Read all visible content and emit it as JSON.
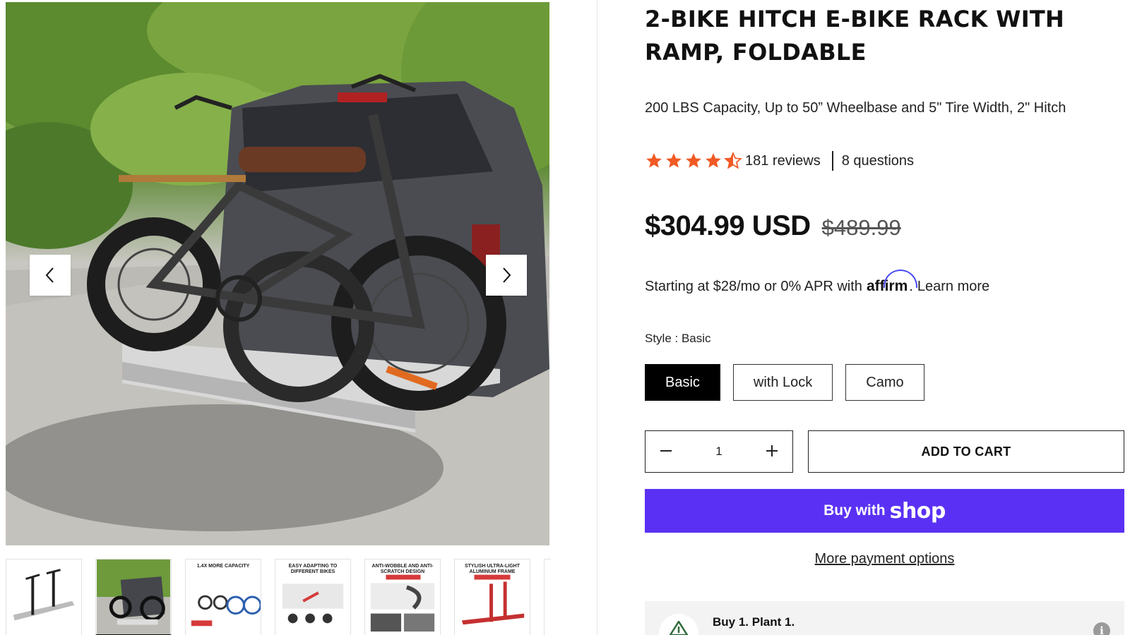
{
  "gallery": {
    "main_image_alt": "",
    "thumbnails": [
      {
        "caption": ""
      },
      {
        "caption": ""
      },
      {
        "caption": "1.4X MORE CAPACITY"
      },
      {
        "caption": "EASY ADAPTING TO DIFFERENT BIKES"
      },
      {
        "caption": "ANTI-WOBBLE AND ANTI-SCRATCH DESIGN"
      },
      {
        "caption": "STYLISH ULTRA-LIGHT ALUMINUM FRAME"
      },
      {
        "caption": ""
      }
    ],
    "prev_icon": "chevron-left-icon",
    "next_icon": "chevron-right-icon"
  },
  "product": {
    "title": "2-BIKE HITCH E-BIKE RACK WITH RAMP, FOLDABLE",
    "subtitle": "200 LBS Capacity, Up to 50” Wheelbase and 5\" Tire Width, 2\" Hitch",
    "rating_value": 4.5,
    "reviews_label": "181 reviews",
    "questions_label": "8 questions",
    "price": "$304.99 USD",
    "compare_price": "$489.99",
    "star_color": "#f15a24"
  },
  "affirm": {
    "prefix": "Starting at $28/mo or 0% APR with",
    "logo": "affirm",
    "suffix": ".",
    "learn_more": "Learn more"
  },
  "style": {
    "label": "Style : Basic",
    "options": [
      "Basic",
      "with Lock",
      "Camo"
    ],
    "selected": "Basic"
  },
  "purchase": {
    "quantity": "1",
    "decrease_icon": "minus-icon",
    "increase_icon": "plus-icon",
    "add_to_cart": "ADD TO CART",
    "buy_with": "Buy with",
    "shop": "shop",
    "buy_color": "#5a31f4",
    "more_payment": "More payment options"
  },
  "plant": {
    "label": "Buy 1. Plant 1.",
    "info_icon": "i"
  }
}
